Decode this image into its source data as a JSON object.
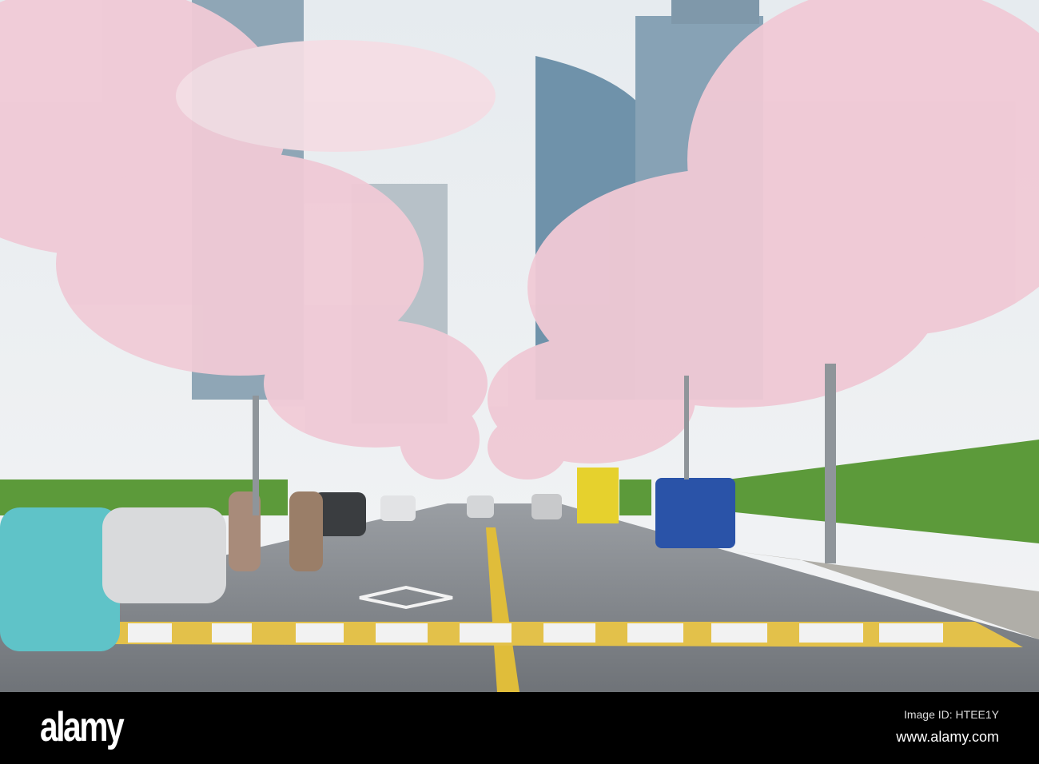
{
  "watermark": {
    "logo": "alamy",
    "image_id": "Image ID: HTEE1Y",
    "website": "www.alamy.com"
  },
  "photo": {
    "subject": "cherry-blossom street",
    "colors": {
      "sky": "#e9edf0",
      "blossom": "#f1cdd8",
      "road": "#7b7f84",
      "line": "#e8c23a"
    }
  }
}
